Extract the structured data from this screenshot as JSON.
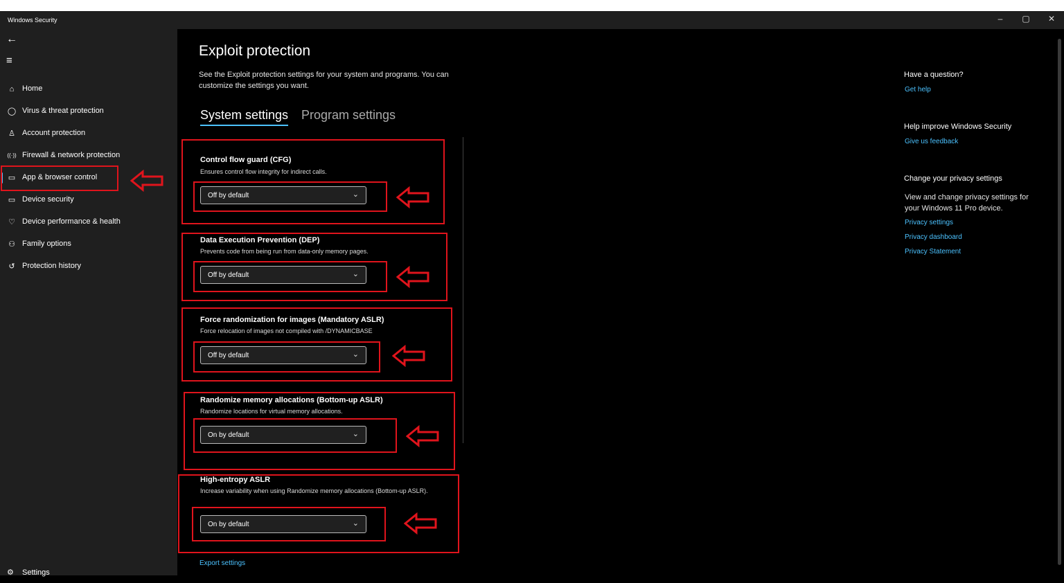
{
  "window": {
    "title": "Windows Security",
    "controls": {
      "minimize": "–",
      "maximize": "▢",
      "close": "✕"
    }
  },
  "sidebar": {
    "back_icon": "←",
    "menu_icon": "≡",
    "items": [
      {
        "label": "Home",
        "icon": "⌂"
      },
      {
        "label": "Virus & threat protection",
        "icon": "◯"
      },
      {
        "label": "Account protection",
        "icon": "♙"
      },
      {
        "label": "Firewall & network protection",
        "icon": "((·))"
      },
      {
        "label": "App & browser control",
        "icon": "▭",
        "active": true
      },
      {
        "label": "Device security",
        "icon": "▭"
      },
      {
        "label": "Device performance & health",
        "icon": "♡"
      },
      {
        "label": "Family options",
        "icon": "⚇"
      },
      {
        "label": "Protection history",
        "icon": "↺"
      }
    ],
    "settings": {
      "label": "Settings",
      "icon": "⚙"
    }
  },
  "main": {
    "title": "Exploit protection",
    "description": "See the Exploit protection settings for your system and programs.  You can customize the settings you want.",
    "tabs": [
      {
        "label": "System settings",
        "selected": true
      },
      {
        "label": "Program settings",
        "selected": false
      }
    ],
    "settings": [
      {
        "title": "Control flow guard (CFG)",
        "description": "Ensures control flow integrity for indirect calls.",
        "value": "Off by default"
      },
      {
        "title": "Data Execution Prevention (DEP)",
        "description": "Prevents code from being run from data-only memory pages.",
        "value": "Off by default"
      },
      {
        "title": "Force randomization for images (Mandatory ASLR)",
        "description": "Force relocation of images not compiled with /DYNAMICBASE",
        "value": "Off by default"
      },
      {
        "title": "Randomize memory allocations (Bottom-up ASLR)",
        "description": "Randomize locations for virtual memory allocations.",
        "value": "On by default"
      },
      {
        "title": "High-entropy ASLR",
        "description": "Increase variability when using Randomize memory allocations (Bottom-up ASLR).",
        "value": "On by default"
      }
    ],
    "dropdown_chevron": "⌄",
    "export_label": "Export settings"
  },
  "right": {
    "question_title": "Have a question?",
    "get_help": "Get help",
    "improve_title": "Help improve Windows Security",
    "feedback": "Give us feedback",
    "privacy_title": "Change your privacy settings",
    "privacy_desc": "View and change privacy settings for your Windows 11 Pro device.",
    "privacy_settings": "Privacy settings",
    "privacy_dashboard": "Privacy dashboard",
    "privacy_statement": "Privacy Statement"
  },
  "colors": {
    "accent": "#4cc2ff",
    "annotation": "#e0141c",
    "sidebar_bg": "#1f1f1f"
  }
}
